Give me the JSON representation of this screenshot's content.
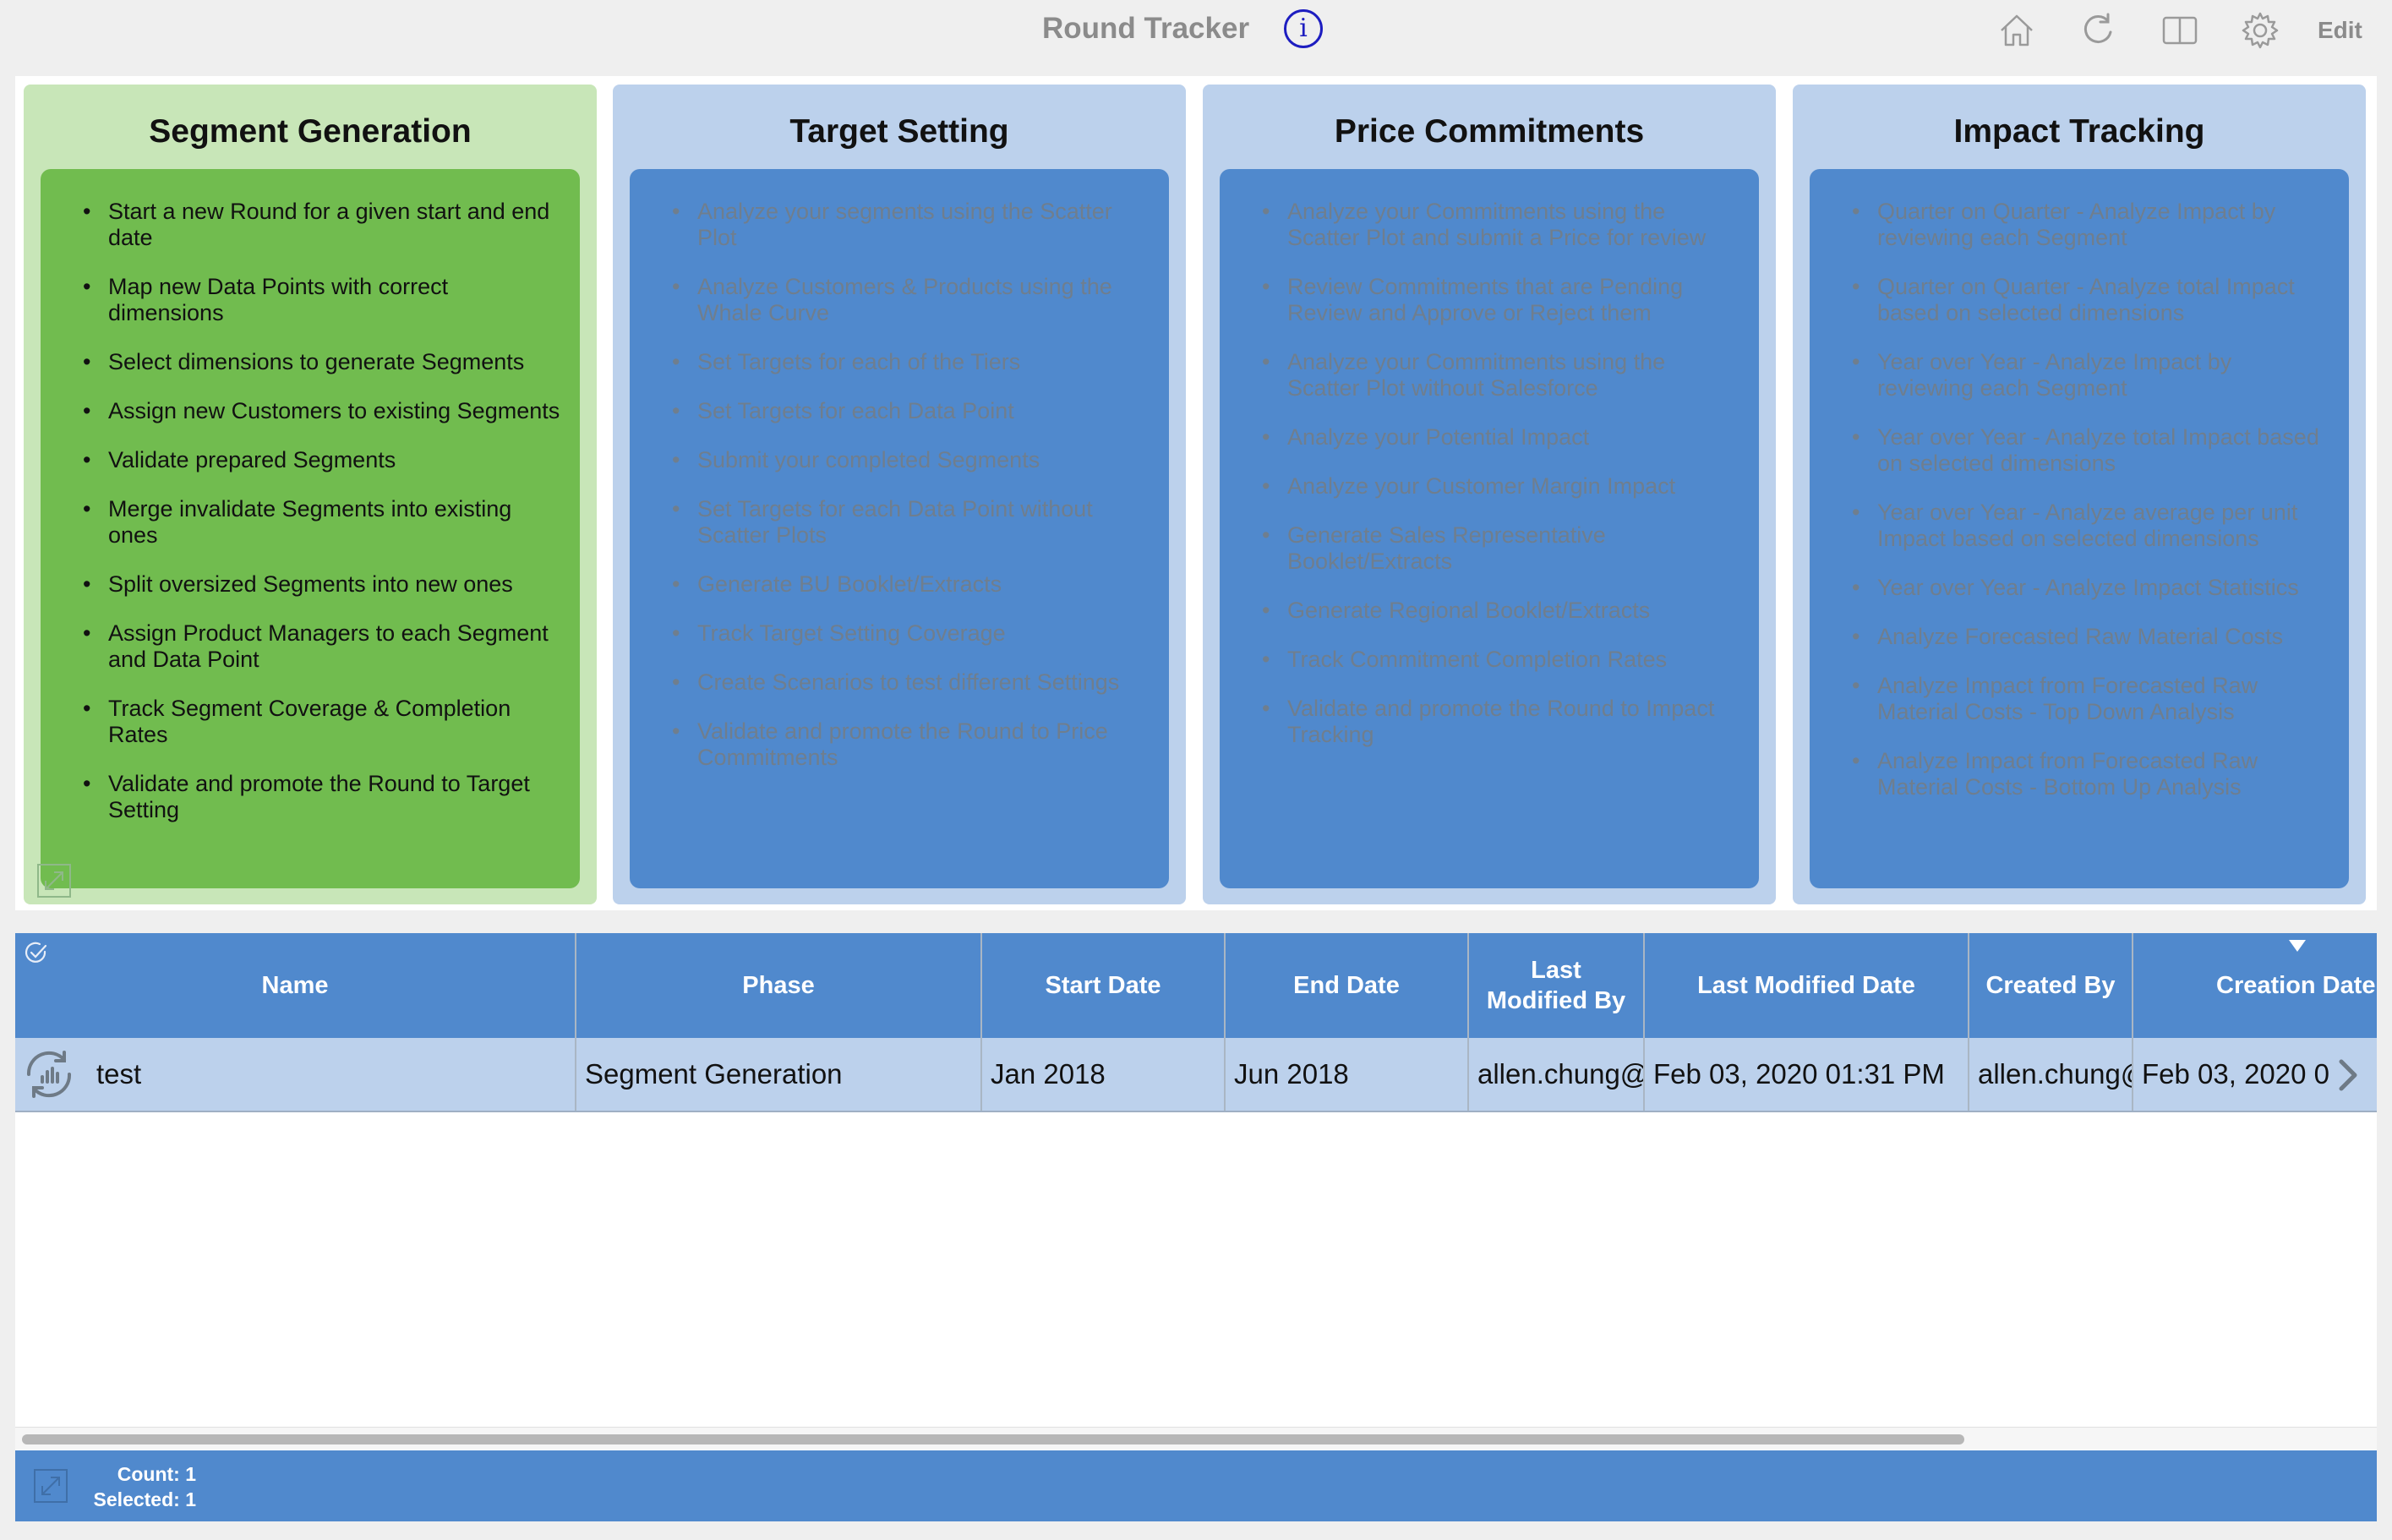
{
  "header": {
    "title": "Round Tracker",
    "info_label": "i",
    "icons": [
      "home-icon",
      "refresh-icon",
      "book-icon",
      "gear-icon"
    ],
    "edit_label": "Edit"
  },
  "phases": [
    {
      "title": "Segment Generation",
      "active": true,
      "items": [
        "Start a new Round for a given start and end date",
        "Map new Data Points with correct dimensions",
        "Select dimensions to generate Segments",
        "Assign new Customers to existing Segments",
        "Validate prepared Segments",
        "Merge invalidate Segments into existing ones",
        "Split oversized Segments into new ones",
        "Assign Product Managers to each Segment and Data Point",
        "Track Segment Coverage & Completion Rates",
        "Validate and promote the Round to Target Setting"
      ]
    },
    {
      "title": "Target Setting",
      "active": false,
      "items": [
        "Analyze your segments using the Scatter Plot",
        "Analyze Customers & Products using the Whale Curve",
        "Set Targets for each of the Tiers",
        "Set Targets for each Data Point",
        "Submit your completed Segments",
        "Set Targets for each Data Point without Scatter Plots",
        "Generate BU Booklet/Extracts",
        "Track Target Setting Coverage",
        "Create Scenarios to test different Settings",
        "Validate and promote the Round to Price Commitments"
      ]
    },
    {
      "title": "Price Commitments",
      "active": false,
      "items": [
        "Analyze your Commitments using the Scatter Plot and submit a Price for review",
        "Review Commitments that are Pending Review and Approve or Reject them",
        "Analyze your Commitments using the Scatter Plot without Salesforce",
        "Analyze your Potential Impact",
        "Analyze your Customer Margin Impact",
        "Generate Sales Representative Booklet/Extracts",
        "Generate Regional Booklet/Extracts",
        "Track Commitment Completion Rates",
        "Validate and promote the Round to Impact Tracking"
      ]
    },
    {
      "title": "Impact Tracking",
      "active": false,
      "items": [
        "Quarter on Quarter - Analyze Impact by reviewing each Segment",
        "Quarter on Quarter - Analyze total Impact based on selected dimensions",
        "Year over Year - Analyze Impact by reviewing each Segment",
        "Year over Year - Analyze total Impact based on selected dimensions",
        "Year over Year - Analyze average per unit Impact based on selected dimensions",
        "Year over Year - Analyze Impact Statistics",
        "Analyze Forecasted Raw Material Costs",
        "Analyze Impact from Forecasted Raw Material Costs - Top Down Analysis",
        "Analyze Impact from Forecasted Raw Material Costs - Bottom Up Analysis"
      ]
    }
  ],
  "table": {
    "columns": [
      "Name",
      "Phase",
      "Start Date",
      "End Date",
      "Last Modified By",
      "Last Modified Date",
      "Created By",
      "Creation Date"
    ],
    "rows": [
      {
        "name": "test",
        "phase": "Segment Generation",
        "start_date": "Jan 2018",
        "end_date": "Jun 2018",
        "last_modified_by": "allen.chung@",
        "last_modified_date": "Feb 03, 2020 01:31 PM",
        "created_by": "allen.chung@",
        "creation_date": "Feb 03, 2020 0"
      }
    ],
    "sorted_column": "Creation Date"
  },
  "footer": {
    "count_label": "Count: 1",
    "selected_label": "Selected: 1"
  },
  "colors": {
    "active_outer": "#c8e6b8",
    "active_inner": "#71bc4f",
    "inactive_outer": "#bcd1ec",
    "inactive_inner": "#5089cd",
    "header_blue": "#5089cd",
    "row_selected": "#bcd1ec",
    "info_blue": "#1d1dc0"
  }
}
